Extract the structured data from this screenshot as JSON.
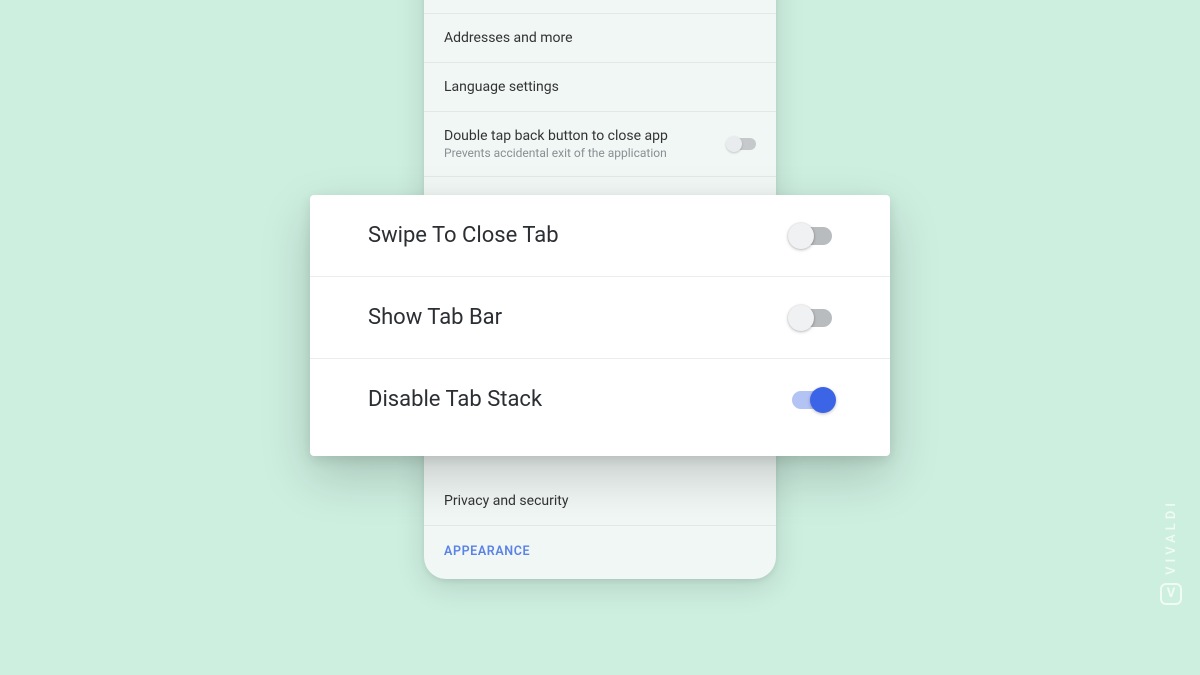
{
  "background": {
    "items": [
      {
        "title": "Addresses and more"
      },
      {
        "title": "Language settings"
      },
      {
        "title": "Double tap back button to close app",
        "subtitle": "Prevents accidental exit of the application",
        "toggle": false
      }
    ],
    "privacy": "Privacy and security",
    "section": "APPEARANCE"
  },
  "modal": {
    "rows": [
      {
        "label": "Swipe To Close Tab",
        "on": false
      },
      {
        "label": "Show Tab Bar",
        "on": false
      },
      {
        "label": "Disable Tab Stack",
        "on": true
      }
    ]
  },
  "watermark": "VIVALDI"
}
